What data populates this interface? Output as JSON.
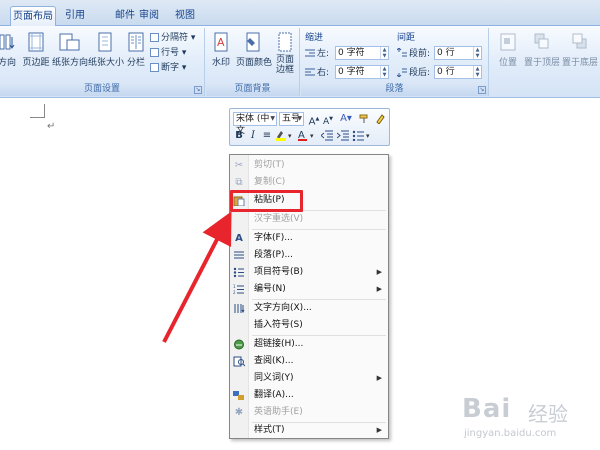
{
  "ribbon": {
    "tabs": [
      "页面布局",
      "引用",
      "邮件",
      "审阅",
      "视图"
    ],
    "active_tab": "页面布局",
    "page_setup": {
      "label": "页面设置",
      "buttons": [
        "方向",
        "页边距",
        "纸张方向",
        "纸张大小",
        "分栏"
      ],
      "small_buttons": [
        "分隔符",
        "行号",
        "断字"
      ]
    },
    "page_background": {
      "label": "页面背景",
      "buttons": [
        "水印",
        "页面颜色",
        "页面\n边框"
      ]
    },
    "paragraph": {
      "label": "段落",
      "indent_title": "缩进",
      "spacing_title": "间距",
      "left_label": "左:",
      "left_value": "0 字符",
      "right_label": "右:",
      "right_value": "0 字符",
      "before_label": "段前:",
      "before_value": "0 行",
      "after_label": "段后:",
      "after_value": "0 行"
    },
    "arrange": {
      "buttons": [
        "位置",
        "置于顶层",
        "置于底层"
      ]
    }
  },
  "mini_toolbar": {
    "font": "宋体 (中文",
    "size": "五号",
    "row1_icons": [
      "grow-font-icon",
      "shrink-font-icon",
      "styles-icon",
      "format-painter-icon",
      "highlight-pen-icon"
    ],
    "bold": "B",
    "italic": "I",
    "center": "≡"
  },
  "context_menu": {
    "items": [
      {
        "label": "剪切(T)",
        "icon": "scissors-icon",
        "disabled": true
      },
      {
        "label": "复制(C)",
        "icon": "copy-icon",
        "disabled": true
      },
      {
        "label": "粘贴(P)",
        "icon": "paste-icon",
        "disabled": false
      },
      {
        "label": "汉字重选(V)",
        "icon": "",
        "disabled": true
      },
      {
        "label": "字体(F)...",
        "icon": "font-icon",
        "disabled": false
      },
      {
        "label": "段落(P)...",
        "icon": "paragraph-icon",
        "disabled": false
      },
      {
        "label": "项目符号(B)",
        "icon": "bullets-icon",
        "disabled": false,
        "submenu": true
      },
      {
        "label": "编号(N)",
        "icon": "numbering-icon",
        "disabled": false,
        "submenu": true
      },
      {
        "label": "文字方向(X)...",
        "icon": "text-direction-icon",
        "disabled": false
      },
      {
        "label": "插入符号(S)",
        "icon": "",
        "disabled": false
      },
      {
        "label": "超链接(H)...",
        "icon": "hyperlink-icon",
        "disabled": false
      },
      {
        "label": "查阅(K)...",
        "icon": "research-icon",
        "disabled": false
      },
      {
        "label": "同义词(Y)",
        "icon": "",
        "disabled": false,
        "submenu": true
      },
      {
        "label": "翻译(A)...",
        "icon": "translate-icon",
        "disabled": false
      },
      {
        "label": "英语助手(E)",
        "icon": "english-assistant-icon",
        "disabled": true
      },
      {
        "label": "样式(T)",
        "icon": "",
        "disabled": false,
        "submenu": true
      }
    ]
  },
  "document": {
    "paragraph_mark": "↵"
  },
  "annotation": {
    "highlight_color": "#e8242d"
  },
  "watermark": {
    "brand": "Bai",
    "brand_cn": "经验",
    "url": "jingyan.baidu.com"
  }
}
